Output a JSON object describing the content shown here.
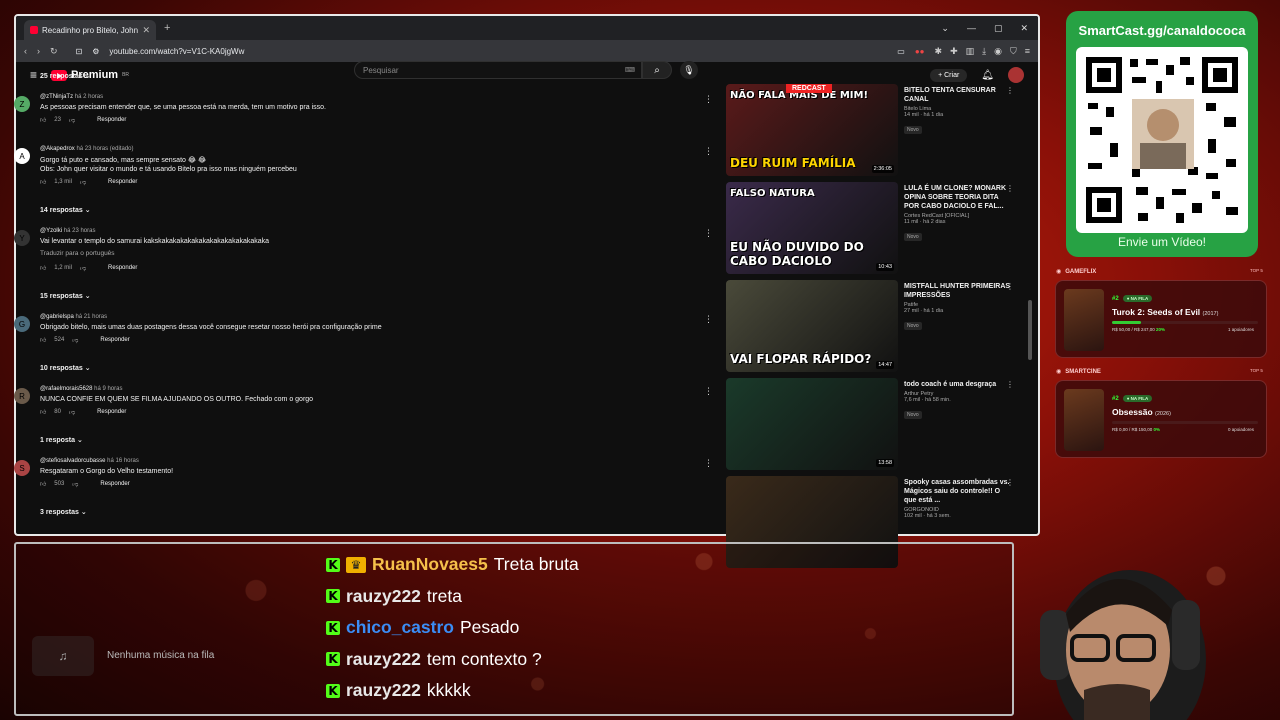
{
  "browser": {
    "tab_title": "Recadinho pro Bitelo, John e to...",
    "url": "youtube.com/watch?v=V1C-KA0jgWw",
    "youtube_badge": "Premium",
    "youtube_region": "BR",
    "search_placeholder": "Pesquisar",
    "create_label": "Criar"
  },
  "comments": [
    {
      "type": "replies",
      "label": "25 respostas"
    },
    {
      "author": "@zTNinjaTz",
      "time": "há 2 horas",
      "text": "As pessoas precisam entender que, se uma pessoa está na merda, tem um motivo pra isso.",
      "likes": "23",
      "reply": "Responder"
    },
    {
      "author": "@Akapedrox",
      "time": "há 23 horas (editado)",
      "text": "Gorgo tá puto e cansado, mas sempre sensato 😂 😂",
      "text2": "Obs: John quer visitar o mundo e tá usando Bitelo pra isso mas ninguém percebeu",
      "likes": "1,3 mil",
      "reply": "Responder"
    },
    {
      "type": "replies",
      "label": "14 respostas"
    },
    {
      "author": "@Yzolki",
      "time": "há 23 horas",
      "text": "Vai levantar o templo do samurai kakskakakakakakakakakakakakakakaka",
      "translate": "Traduzir para o português",
      "likes": "1,2 mil",
      "reply": "Responder"
    },
    {
      "type": "replies",
      "label": "15 respostas"
    },
    {
      "author": "@gabrielspa",
      "time": "há 21 horas",
      "text": "Obrigado bitelo, mais umas duas postagens dessa você consegue resetar nosso herói pra configuração prime",
      "likes": "524",
      "reply": "Responder"
    },
    {
      "type": "replies",
      "label": "10 respostas"
    },
    {
      "author": "@rafaelmorais5628",
      "time": "há 9 horas",
      "text": "NUNCA CONFIE EM QUEM SE FILMA AJUDANDO OS OUTRO. Fechado com o gorgo",
      "likes": "80",
      "reply": "Responder"
    },
    {
      "type": "replies",
      "label": "1 resposta"
    },
    {
      "author": "@stefiosalvadorcubasse",
      "time": "há 16 horas",
      "text": "Resgataram o Gorgo do Velho testamento!",
      "likes": "503",
      "reply": "Responder"
    },
    {
      "type": "replies",
      "label": "3 respostas"
    }
  ],
  "sidebar": [
    {
      "title": "BITELO TENTA CENSURAR CANAL",
      "channel": "Bitelo Lima",
      "stats": "14 mil · há 1 dia",
      "badge": "Novo",
      "caption": "DEU RUIM FAMÍLIA",
      "topcap": "NÃO FALA MAIS DE MIM!",
      "brand": "REDCAST",
      "duration": "2:36:05",
      "color": "#5a1a1a"
    },
    {
      "title": "LULA É UM CLONE? MONARK OPINA SOBRE TEORIA DITA POR CABO DACIOLO E FAL...",
      "channel": "Cortes RedCast [OFICIAL]",
      "stats": "11 mil · há 2 dias",
      "badge": "Novo",
      "caption": "EU NÃO DUVIDO DO CABO DACIOLO",
      "topcap": "FALSO NATURA",
      "duration": "10:43",
      "color": "#3a2a4a"
    },
    {
      "title": "MISTFALL HUNTER PRIMEIRAS IMPRESSÕES",
      "channel": "Patife",
      "stats": "27 mil · há 1 dia",
      "badge": "Novo",
      "caption": "VAI FLOPAR RÁPIDO?",
      "duration": "14:47",
      "color": "#4a4a3a"
    },
    {
      "title": "todo coach é uma desgraça",
      "channel": "Arthur Petry",
      "stats": "7,6 mil · há 58 min.",
      "badge": "Novo",
      "caption": "",
      "duration": "13:58",
      "color": "#1a3a2a"
    },
    {
      "title": "Spooky casas assombradas vs. Mágicos saiu do controle!! O que está ...",
      "channel": "GORGONOID",
      "stats": "102 mil · há 3 sem.",
      "badge": "",
      "caption": "",
      "duration": "",
      "color": "#3a2a1a"
    }
  ],
  "qr": {
    "title": "SmartCast.gg/canaldococa",
    "footer": "Envie um Vídeo!"
  },
  "cards": [
    {
      "section": "GAMEFLIX",
      "top": "TOP 5",
      "rank": "#2",
      "status": "NA FILA",
      "name": "Turok 2: Seeds of Evil",
      "year": "(2017)",
      "progress": 20,
      "money": "R$ 50,00 / R$ 247,00",
      "percent": "20%",
      "supporters": "1 apoiadores"
    },
    {
      "section": "SMARTCINE",
      "top": "TOP 5",
      "rank": "#2",
      "status": "NA FILA",
      "name": "Obsessão",
      "year": "(2026)",
      "progress": 0,
      "money": "R$ 0,00 / R$ 150,00",
      "percent": "0%",
      "supporters": "0 apoiadores"
    }
  ],
  "music": {
    "empty_label": "Nenhuma música na fila"
  },
  "chat": [
    {
      "user": "RuanNovaes5",
      "message": "Treta bruta",
      "color": "#f5c04a",
      "crown": true
    },
    {
      "user": "rauzy222",
      "message": "treta",
      "color": "#e8e8e8",
      "crown": false
    },
    {
      "user": "chico_castro",
      "message": "Pesado",
      "color": "#3b8df5",
      "crown": false
    },
    {
      "user": "rauzy222",
      "message": "tem contexto ?",
      "color": "#e8e8e8",
      "crown": false
    },
    {
      "user": "rauzy222",
      "message": "kkkkk",
      "color": "#e8e8e8",
      "crown": false
    }
  ]
}
